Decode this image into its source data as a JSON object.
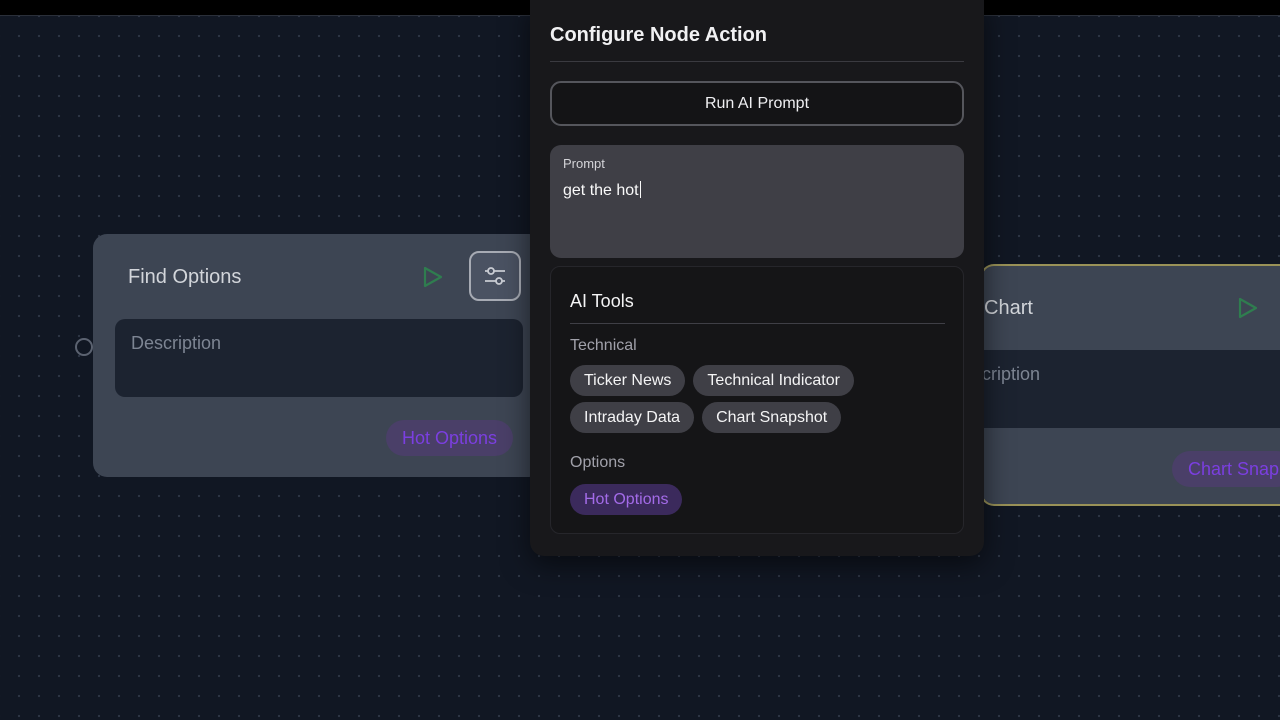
{
  "canvas": {
    "left_node": {
      "title": "Find Options",
      "description_placeholder": "Description",
      "tag": "Hot Options",
      "run_icon": "play-icon",
      "settings_icon": "sliders-icon"
    },
    "right_node": {
      "title": "Chart",
      "description_placeholder": "cription",
      "tag": "Chart Snap",
      "run_icon": "play-icon"
    }
  },
  "panel": {
    "title": "Configure Node Action",
    "run_button_label": "Run AI Prompt",
    "prompt": {
      "label": "Prompt",
      "value": "get the hot"
    },
    "tools": {
      "title": "AI Tools",
      "sections": [
        {
          "label": "Technical",
          "items": [
            {
              "label": "Ticker News",
              "active": false
            },
            {
              "label": "Technical Indicator",
              "active": false
            },
            {
              "label": "Intraday Data",
              "active": false
            },
            {
              "label": "Chart Snapshot",
              "active": false
            }
          ]
        },
        {
          "label": "Options",
          "items": [
            {
              "label": "Hot Options",
              "active": true
            }
          ]
        }
      ]
    }
  },
  "colors": {
    "canvas_bg": "#111723",
    "node_bg": "#3d4553",
    "panel_bg": "#18181b",
    "accent_purple": "#a36be8",
    "play_green": "#22c55e",
    "selected_border": "#9a9258"
  }
}
